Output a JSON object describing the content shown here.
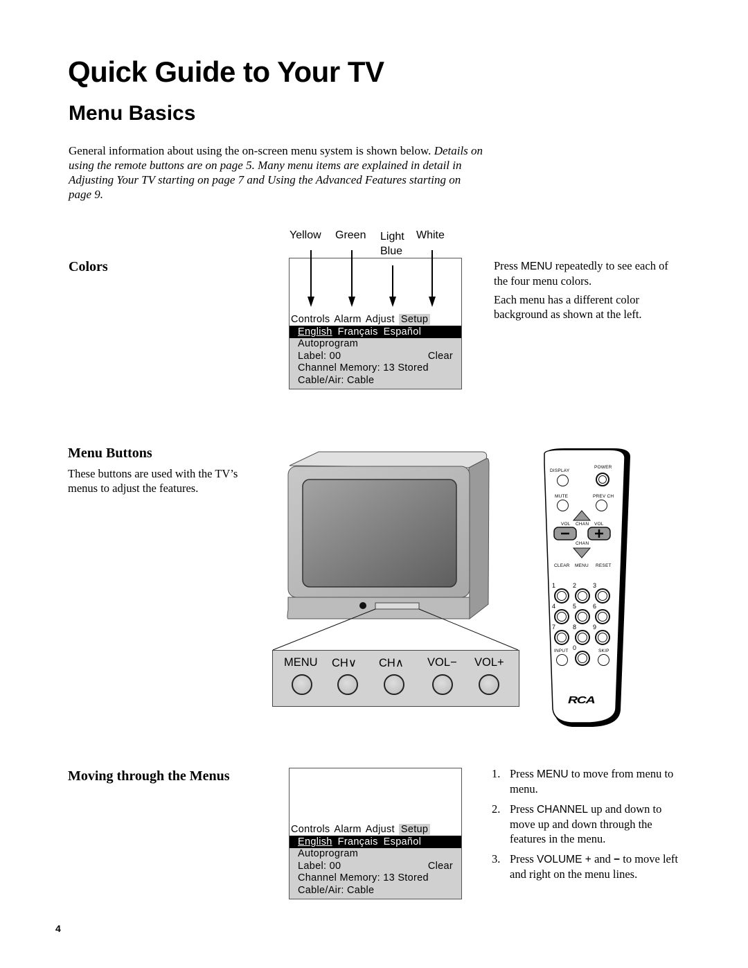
{
  "page": {
    "title": "Quick Guide to Your TV",
    "section_title": "Menu Basics",
    "intro_plain": "General information about using the on-screen menu system is shown below. ",
    "intro_italic": "Details on using the remote buttons are on page 5. Many menu items are explained in detail in Adjusting Your TV starting on page 7 and Using the Advanced Features starting on page 9.",
    "page_number": "4"
  },
  "colors_section": {
    "heading": "Colors",
    "color_labels": [
      "Yellow",
      "Green",
      "Light Blue",
      "White"
    ],
    "note1_pre": "Press ",
    "note1_key": "MENU",
    "note1_post": " repeatedly to see each of the four menu colors.",
    "note2": "Each menu has a different color background as shown at the left."
  },
  "menu_screen": {
    "tabs": [
      "Controls",
      "Alarm",
      "Adjust",
      "Setup"
    ],
    "active_tab": "Setup",
    "languages": [
      "English",
      "Français",
      "Español"
    ],
    "selected_language": "English",
    "lines": [
      {
        "left": "Autoprogram",
        "right": ""
      },
      {
        "left": "Label:  00",
        "right": "Clear"
      },
      {
        "left": "Channel Memory: 13 Stored",
        "right": ""
      },
      {
        "left": "Cable/Air: Cable",
        "right": ""
      }
    ]
  },
  "menu_buttons_section": {
    "heading": "Menu Buttons",
    "description": "These buttons are used with the TV’s menus to adjust the features.",
    "front_panel_buttons": [
      "MENU",
      "CH∨",
      "CH∧",
      "VOL−",
      "VOL+"
    ]
  },
  "remote": {
    "brand": "RCA",
    "labels": {
      "display": "DISPLAY",
      "power": "POWER",
      "mute": "MUTE",
      "prev_ch": "PREV CH",
      "vol_left": "VOL",
      "chan_up": "CHAN",
      "vol_right": "VOL",
      "chan_down": "CHAN",
      "clear": "CLEAR",
      "menu": "MENU",
      "reset": "RESET",
      "input": "INPUT",
      "skip": "SKIP"
    },
    "digits": [
      "1",
      "2",
      "3",
      "4",
      "5",
      "6",
      "7",
      "8",
      "9",
      "0"
    ]
  },
  "moving_section": {
    "heading": "Moving through the Menus",
    "steps": [
      {
        "num": "1.",
        "pre": "Press ",
        "key": "MENU",
        "post": " to move from menu to menu."
      },
      {
        "num": "2.",
        "pre": "Press ",
        "key": "CHANNEL",
        "post": " up and down to move up and down through the features in the menu."
      },
      {
        "num": "3.",
        "pre": "Press ",
        "key": "VOLUME + ",
        "mid": "and ",
        "key2": "−",
        "post": "  to move left and right on the menu lines."
      }
    ]
  }
}
